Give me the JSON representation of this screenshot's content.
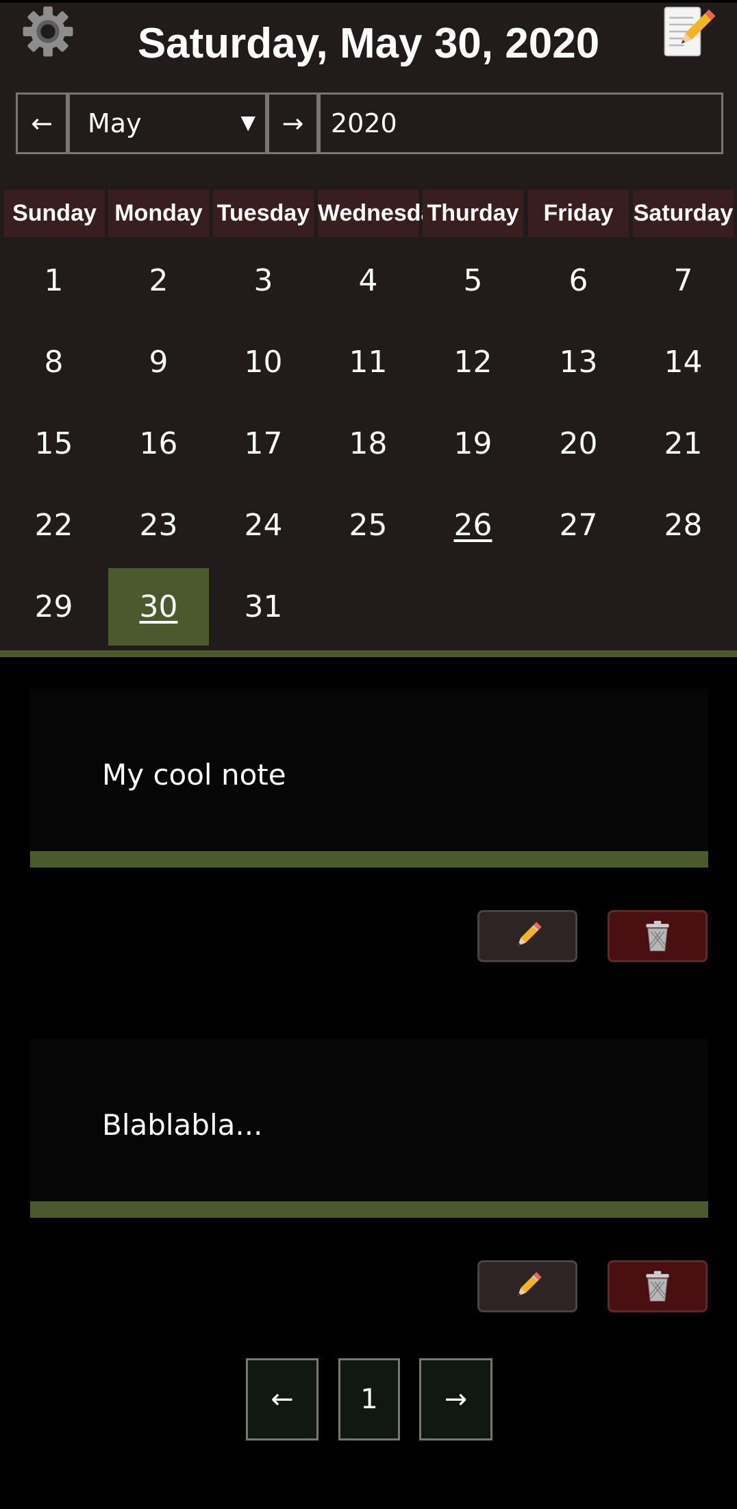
{
  "header": {
    "title": "Saturday, May 30, 2020",
    "settings_icon": "gear-icon",
    "new_note_icon": "notepad-icon"
  },
  "nav": {
    "prev_arrow": "←",
    "month": "May",
    "month_caret": "▼",
    "next_arrow": "→",
    "year": "2020"
  },
  "calendar": {
    "weekdays": [
      "Sunday",
      "Monday",
      "Tuesday",
      "Wednesday",
      "Thurday",
      "Friday",
      "Saturday"
    ],
    "days": [
      "1",
      "2",
      "3",
      "4",
      "5",
      "6",
      "7",
      "8",
      "9",
      "10",
      "11",
      "12",
      "13",
      "14",
      "15",
      "16",
      "17",
      "18",
      "19",
      "20",
      "21",
      "22",
      "23",
      "24",
      "25",
      "26",
      "27",
      "28",
      "29",
      "30",
      "31"
    ],
    "selected_day": "30",
    "today_day": "26"
  },
  "notes": [
    {
      "text": "My cool note",
      "edit_icon": "pencil-icon",
      "delete_icon": "trash-icon"
    },
    {
      "text": "Blablabla...",
      "edit_icon": "pencil-icon",
      "delete_icon": "trash-icon"
    }
  ],
  "pagination": {
    "prev": "←",
    "page": "1",
    "next": "→"
  },
  "colors": {
    "panel": "#211b1b",
    "weekday_header": "#381e1e",
    "accent_green": "#4b5a2d",
    "delete_red": "#4a0f10"
  }
}
